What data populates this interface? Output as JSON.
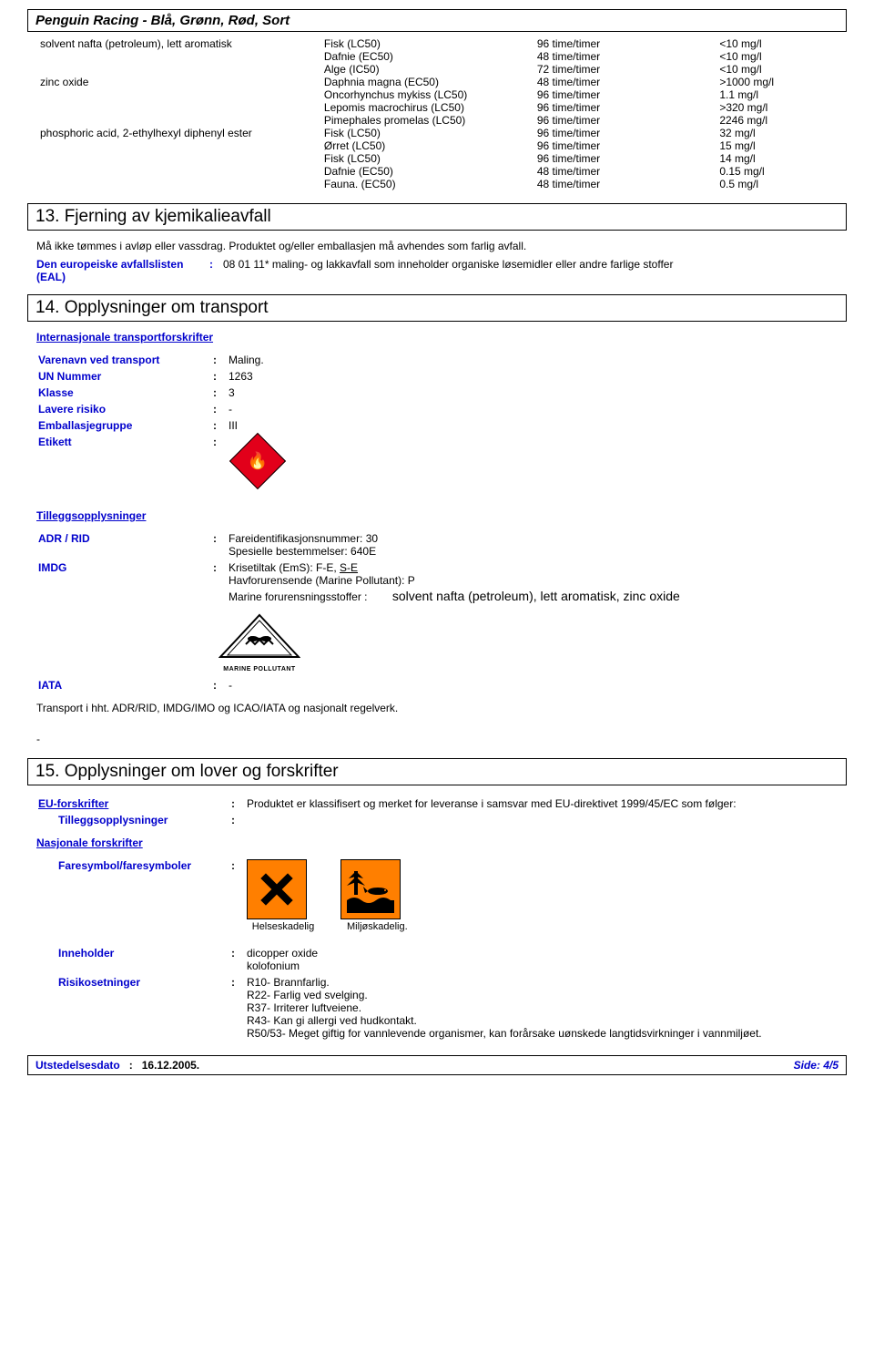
{
  "title": "Penguin Racing - Blå, Grønn, Rød, Sort",
  "eco": {
    "rows": [
      {
        "sub": "solvent nafta (petroleum), lett aromatisk",
        "test": "Fisk (LC50)",
        "exp": "96 time/timer",
        "val": "<10 mg/l"
      },
      {
        "sub": "",
        "test": "Dafnie (EC50)",
        "exp": "48 time/timer",
        "val": "<10 mg/l"
      },
      {
        "sub": "",
        "test": "Alge (IC50)",
        "exp": "72 time/timer",
        "val": "<10 mg/l"
      },
      {
        "sub": "zinc oxide",
        "test": "Daphnia magna (EC50)",
        "exp": "48 time/timer",
        "val": ">1000 mg/l"
      },
      {
        "sub": "",
        "test": "Oncorhynchus mykiss (LC50)",
        "exp": "96 time/timer",
        "val": "1.1 mg/l"
      },
      {
        "sub": "",
        "test": "Lepomis macrochirus (LC50)",
        "exp": "96 time/timer",
        "val": ">320 mg/l"
      },
      {
        "sub": "",
        "test": "Pimephales promelas (LC50)",
        "exp": "96 time/timer",
        "val": "2246 mg/l"
      },
      {
        "sub": "phosphoric acid, 2-ethylhexyl diphenyl ester",
        "test": "Fisk (LC50)",
        "exp": "96 time/timer",
        "val": "32 mg/l"
      },
      {
        "sub": "",
        "test": "Ørret (LC50)",
        "exp": "96 time/timer",
        "val": "15 mg/l"
      },
      {
        "sub": "",
        "test": "Fisk (LC50)",
        "exp": "96 time/timer",
        "val": "14 mg/l"
      },
      {
        "sub": "",
        "test": "Dafnie (EC50)",
        "exp": "48 time/timer",
        "val": "0.15 mg/l"
      },
      {
        "sub": "",
        "test": "Fauna. (EC50)",
        "exp": "48 time/timer",
        "val": "0.5 mg/l"
      }
    ]
  },
  "s13": {
    "heading": "13. Fjerning av kjemikalieavfall",
    "text1": "Må ikke tømmes i avløp eller vassdrag. Produktet og/eller emballasjen må avhendes som farlig avfall.",
    "eal_label": "Den europeiske avfallslisten (EAL)",
    "eal_value": "08 01 11* maling- og lakkavfall som inneholder organiske løsemidler eller andre farlige stoffer"
  },
  "s14": {
    "heading": "14. Opplysninger om transport",
    "intl_label": "Internasjonale transportforskrifter",
    "rows": {
      "varenavn_k": "Varenavn ved transport",
      "varenavn_v": "Maling.",
      "un_k": "UN Nummer",
      "un_v": "1263",
      "klasse_k": "Klasse",
      "klasse_v": "3",
      "lavere_k": "Lavere risiko",
      "lavere_v": "-",
      "emb_k": "Emballasjegruppe",
      "emb_v": "III",
      "etikett_k": "Etikett"
    },
    "tillegg_label": "Tilleggsopplysninger",
    "adr_k": "ADR / RID",
    "adr_v1": "Fareidentifikasjonsnummer: 30",
    "adr_v2": "Spesielle bestemmelser: 640E",
    "imdg_k": "IMDG",
    "imdg_v1": "Krisetiltak (EmS): F-E, ",
    "imdg_v1u": "S-E",
    "imdg_v2": "Havforurensende (Marine Pollutant): P",
    "imdg_v3_label": "Marine forurensningsstoffer :",
    "imdg_v3_value": "solvent nafta (petroleum), lett aromatisk, zinc oxide",
    "marine_label": "MARINE POLLUTANT",
    "iata_k": "IATA",
    "iata_v": "-",
    "trans_note": "Transport i hht. ADR/RID, IMDG/IMO og ICAO/IATA og nasjonalt regelverk.",
    "dash": "-"
  },
  "s15": {
    "heading": "15. Opplysninger om lover og forskrifter",
    "eu_k": "EU-forskrifter",
    "eu_v": "Produktet er klassifisert og merket for leveranse i samsvar med EU-direktivet 1999/45/EC som følger:",
    "tillegg_k": "Tilleggsopplysninger",
    "nasj_k": "Nasjonale forskrifter",
    "faresymbol_k": "Faresymbol/faresymboler",
    "haz1_caption": "Helseskadelig",
    "haz2_caption": "Miljøskadelig.",
    "inneholder_k": "Inneholder",
    "inneholder_v1": "dicopper oxide",
    "inneholder_v2": "kolofonium",
    "risiko_k": "Risikosetninger",
    "risiko_v": [
      "R10- Brannfarlig.",
      "R22- Farlig ved svelging.",
      "R37- Irriterer luftveiene.",
      "R43- Kan gi allergi ved hudkontakt.",
      "R50/53- Meget giftig for vannlevende organismer, kan forårsake uønskede langtidsvirkninger i vannmiljøet."
    ]
  },
  "footer": {
    "date_k": "Utstedelsesdato",
    "date_v": "16.12.2005.",
    "page": "Side: 4/5"
  }
}
